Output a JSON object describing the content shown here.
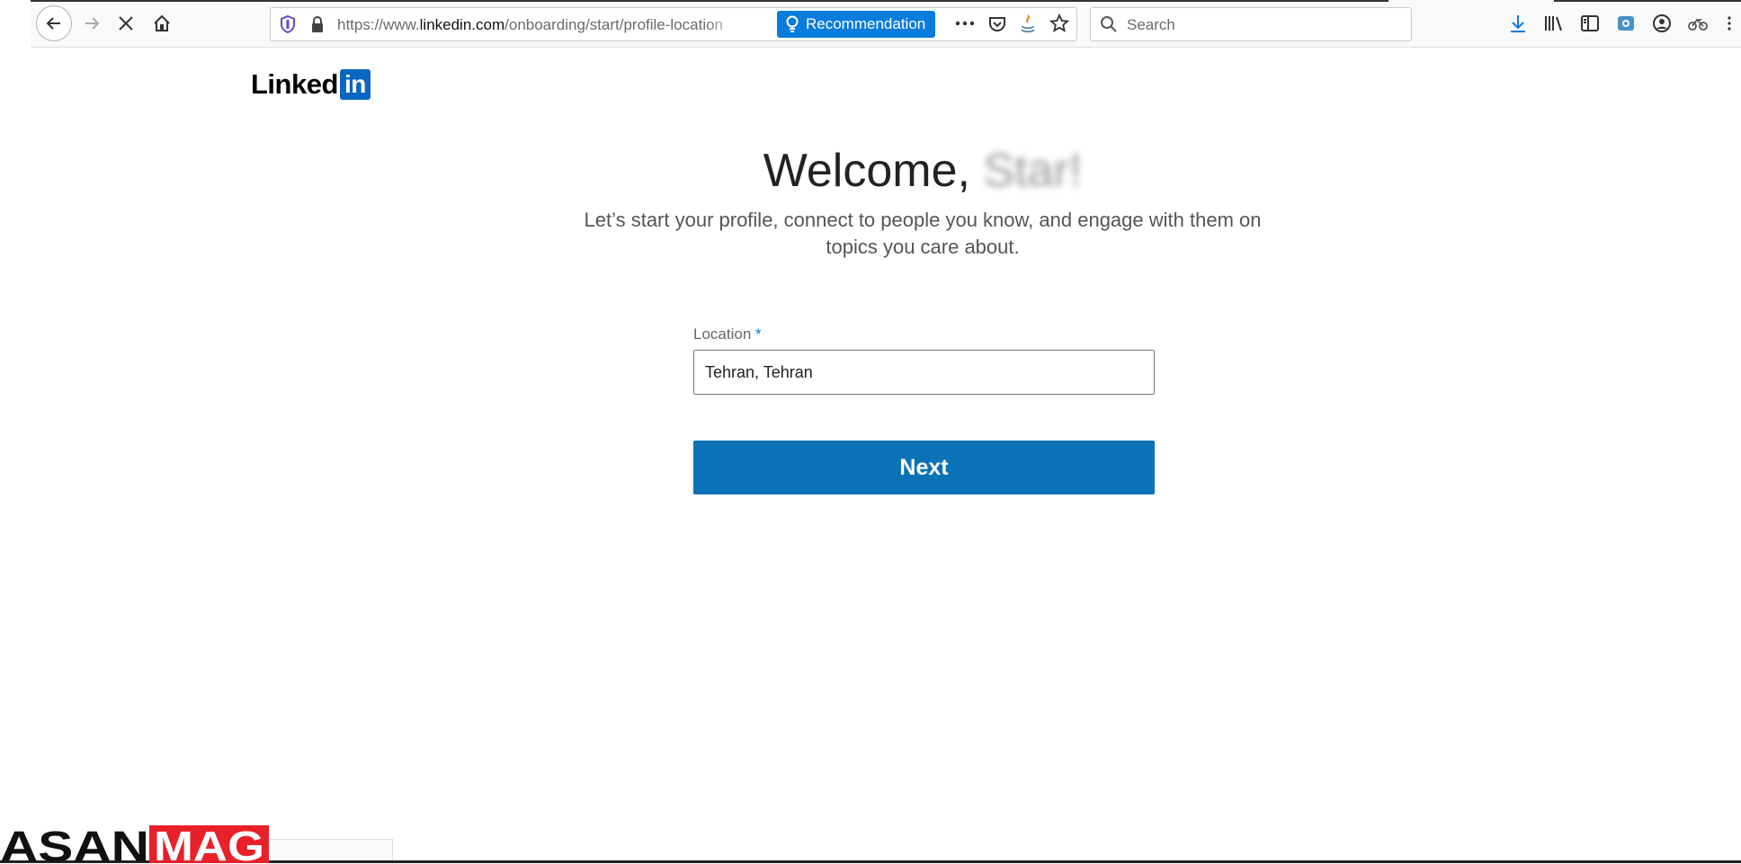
{
  "browser": {
    "url_prefix": "https://www.",
    "url_host": "linkedin.com",
    "url_path": "/onboarding/start/profile-location",
    "recommendation_label": "Recommendation",
    "search_placeholder": "Search"
  },
  "logo": {
    "text": "Linked",
    "badge": "in"
  },
  "welcome": {
    "greeting": "Welcome, ",
    "name": "Star!"
  },
  "subtitle": "Let’s start your profile, connect to people you know, and engage with them on topics you care about.",
  "form": {
    "location_label": "Location",
    "required_mark": "*",
    "location_value": "Tehran, Tehran",
    "next_label": "Next"
  },
  "watermark": {
    "text_left": "ASAN",
    "text_right": "MAG"
  },
  "colors": {
    "linkedin_blue": "#0a66c2",
    "button_blue": "#0a72b5",
    "recommendation_blue": "#0a7cdc",
    "watermark_red": "#e8202a"
  }
}
